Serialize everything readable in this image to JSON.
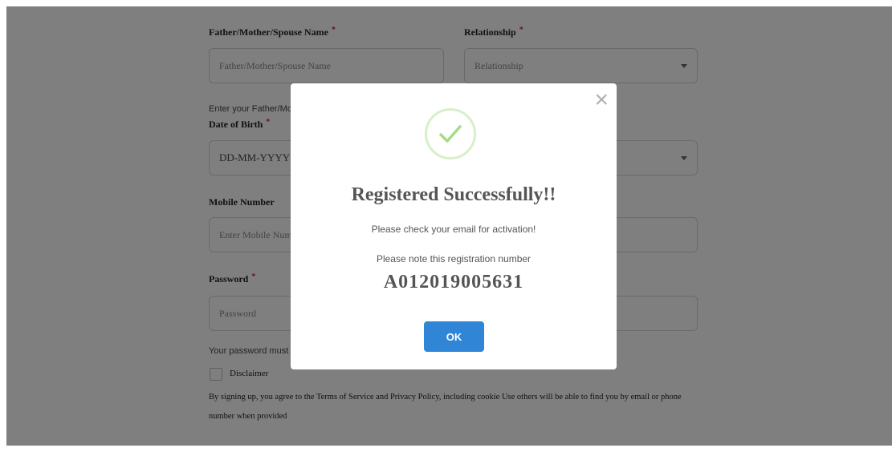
{
  "form": {
    "guardian_label": "Father/Mother/Spouse Name",
    "guardian_placeholder": "Father/Mother/Spouse Name",
    "guardian_hint": "Enter your Father/Mot",
    "relationship_label": "Relationship",
    "relationship_value": "Relationship",
    "dob_label": "Date of Birth",
    "dob_placeholder": "DD-MM-YYYY",
    "mobile_label": "Mobile Number",
    "mobile_placeholder": "Enter Mobile Numbe",
    "password_label": "Password",
    "password_placeholder": "Password",
    "password_hint": "Your password must l",
    "disclaimer_label": "Disclaimer",
    "terms_line1": "By signing up, you agree to the Terms of Service and Privacy Policy, including cookie Use others will be able to find you by email or phone",
    "terms_line2": "number when provided",
    "required_mark": "*"
  },
  "modal": {
    "close_glyph": "×",
    "title": "Registered Successfully!!",
    "message": "Please check your email for activation!",
    "note": "Please note this registration number",
    "registration_number": "A012019005631",
    "ok_label": "OK"
  },
  "colors": {
    "accent": "#3085d6",
    "success": "#a5dc86",
    "required": "#e02424"
  },
  "icons": {
    "success": "check-circle-icon",
    "close": "close-icon",
    "dropdown": "chevron-down-icon"
  }
}
